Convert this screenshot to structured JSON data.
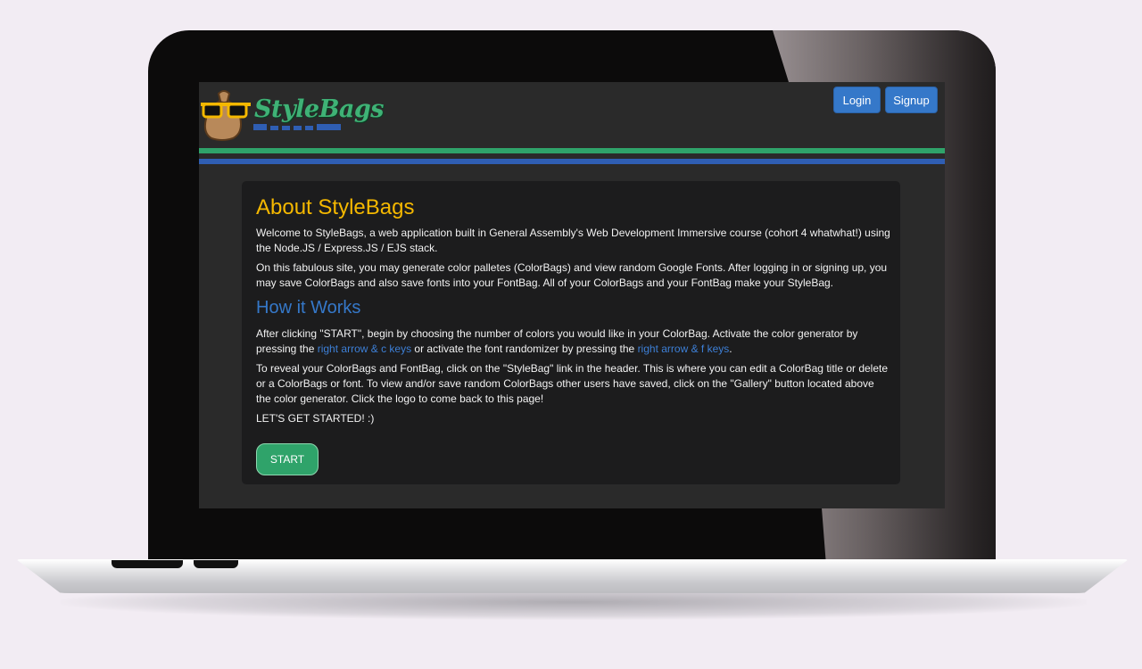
{
  "header": {
    "logo_text": "StyleBags",
    "login_label": "Login",
    "signup_label": "Signup"
  },
  "about": {
    "title": "About StyleBags",
    "paragraph1": "Welcome to StyleBags, a web application built in General Assembly's Web Development Immersive course (cohort 4 whatwhat!) using the Node.JS / Express.JS / EJS stack.",
    "paragraph2": "On this fabulous site, you may generate color palletes (ColorBags) and view random Google Fonts. After logging in or signing up, you may save ColorBags and also save fonts into your FontBag. All of your ColorBags and your FontBag make your StyleBag."
  },
  "how": {
    "title": "How it Works",
    "p1_part1": "After clicking \"START\", begin by choosing the number of colors you would like in your ColorBag. Activate the color generator by pressing the ",
    "p1_key1": "right arrow & c keys",
    "p1_part2": " or activate the font randomizer by pressing the ",
    "p1_key2": "right arrow & f keys",
    "p1_part3": ".",
    "paragraph2": "To reveal your ColorBags and FontBag, click on the \"StyleBag\" link in the header. This is where you can edit a ColorBag title or delete or a ColorBags or font. To view and/or save random ColorBags other users have saved, click on the \"Gallery\" button located above the color generator. Click the logo to come back to this page!",
    "paragraph3": "LET'S GET STARTED! :)"
  },
  "start_label": "START",
  "colors": {
    "accent_yellow": "#f5b800",
    "accent_blue": "#3578c9",
    "accent_green": "#2fa36a",
    "screen_bg": "#2a2a2a",
    "card_bg": "#1c1c1d"
  },
  "icons": {
    "logo": "money-bag-with-sunglasses-icon"
  }
}
